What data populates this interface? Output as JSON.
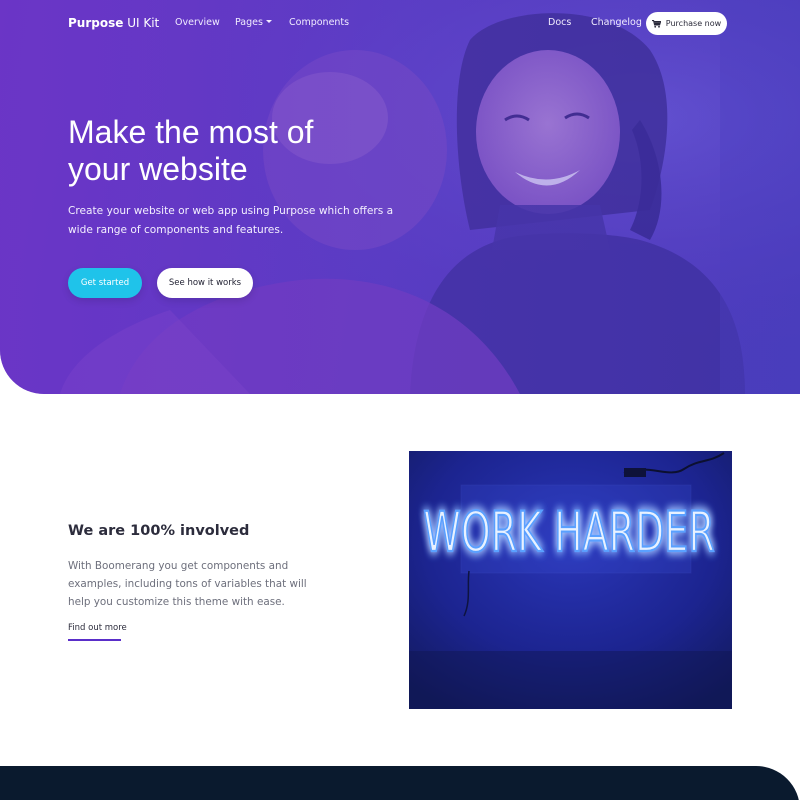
{
  "navbar": {
    "brand_bold": "Purpose",
    "brand_light": "UI Kit",
    "links": {
      "overview": "Overview",
      "pages": "Pages",
      "components": "Components",
      "docs": "Docs",
      "changelog": "Changelog"
    },
    "purchase_label": "Purchase now",
    "purchase_icon": "shopping-cart-icon"
  },
  "hero": {
    "title_line1": "Make the most of",
    "title_line2": "your website",
    "subtitle": "Create your website or web app using Purpose which offers a wide range of components and features.",
    "primary_button": "Get started",
    "secondary_button": "See how it works"
  },
  "feature": {
    "title": "We are 100% involved",
    "text": "With Boomerang you get components and examples, including tons of variables that will help you customize this theme with ease.",
    "link": "Find out more",
    "image_sign_text": "WORK HARDER"
  },
  "colors": {
    "hero_purple": "#6a36c4",
    "accent_cyan": "#1fc3ea",
    "link_underline": "#5a2ec9",
    "footer_dark": "#0a1a2e",
    "neon_blue": "#4a8bff"
  }
}
